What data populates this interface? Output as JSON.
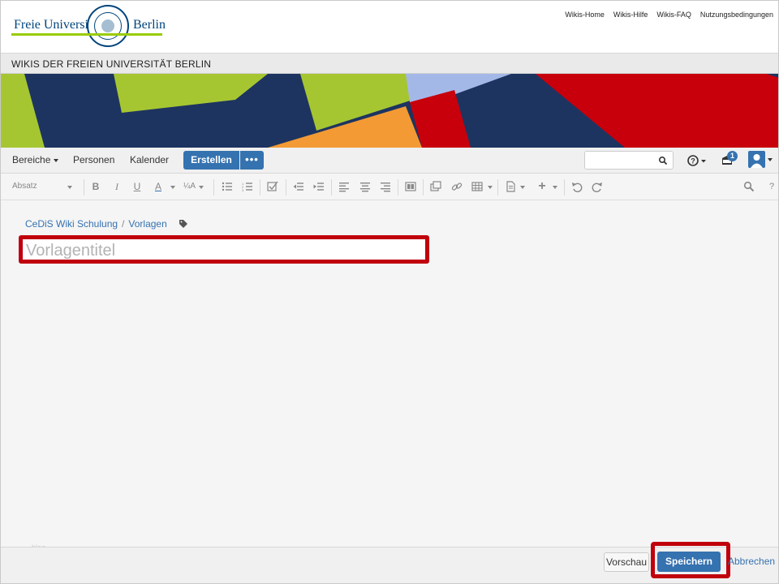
{
  "header": {
    "logo": {
      "left_text": "Freie Universität",
      "right_text": "Berlin"
    },
    "links": [
      "Wikis-Home",
      "Wikis-Hilfe",
      "Wikis-FAQ",
      "Nutzungsbedingungen"
    ],
    "wiki_title": "WIKIS DER FREIEN UNIVERSITÄT BERLIN"
  },
  "nav": {
    "bereiche": "Bereiche",
    "personen": "Personen",
    "kalender": "Kalender",
    "create": "Erstellen",
    "more": "•••",
    "notifications_count": "1"
  },
  "toolbar": {
    "paragraph_style": "Absatz"
  },
  "breadcrumb": {
    "items": [
      "CeDiS Wiki Schulung",
      "Vorlagen"
    ],
    "separator": "/"
  },
  "editor": {
    "title_placeholder": "Vorlagentitel"
  },
  "footer": {
    "blog_label": "blog",
    "preview": "Vorschau",
    "save": "Speichern",
    "cancel": "Abbrechen"
  },
  "colors": {
    "primary": "#3572b0",
    "highlight": "#c0000c",
    "fu_blue": "#00447c",
    "fu_green": "#99cc00"
  }
}
